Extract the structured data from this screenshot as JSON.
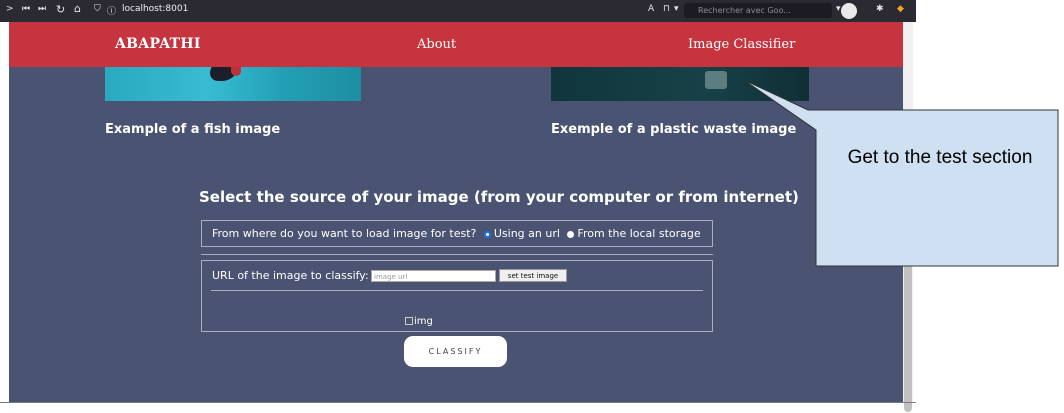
{
  "browser": {
    "url": "localhost:8001",
    "search_placeholder": "Rechercher avec Goo..."
  },
  "nav": {
    "brand": "ABAPATHI",
    "about": "About",
    "classifier": "Image Classifier"
  },
  "examples": {
    "fish_caption": "Example of a fish image",
    "plastic_caption": "Exemple of a plastic waste image"
  },
  "test_section": {
    "title": "Select the source of your image (from your computer or from internet)",
    "question": "From where do you want to load image for test?",
    "option_url": "Using an url",
    "option_local": "From the local storage",
    "selected_option": "Using an url",
    "url_label": "URL of the image to classify:",
    "url_placeholder": "image url",
    "set_button": "set test image",
    "image_alt": "img",
    "classify_button": "CLASSIFY"
  },
  "callout": {
    "text": "Get to the test section"
  },
  "colors": {
    "nav_bg": "#c5343f",
    "page_bg": "#4a5472",
    "callout_bg": "#cfe0f2"
  }
}
